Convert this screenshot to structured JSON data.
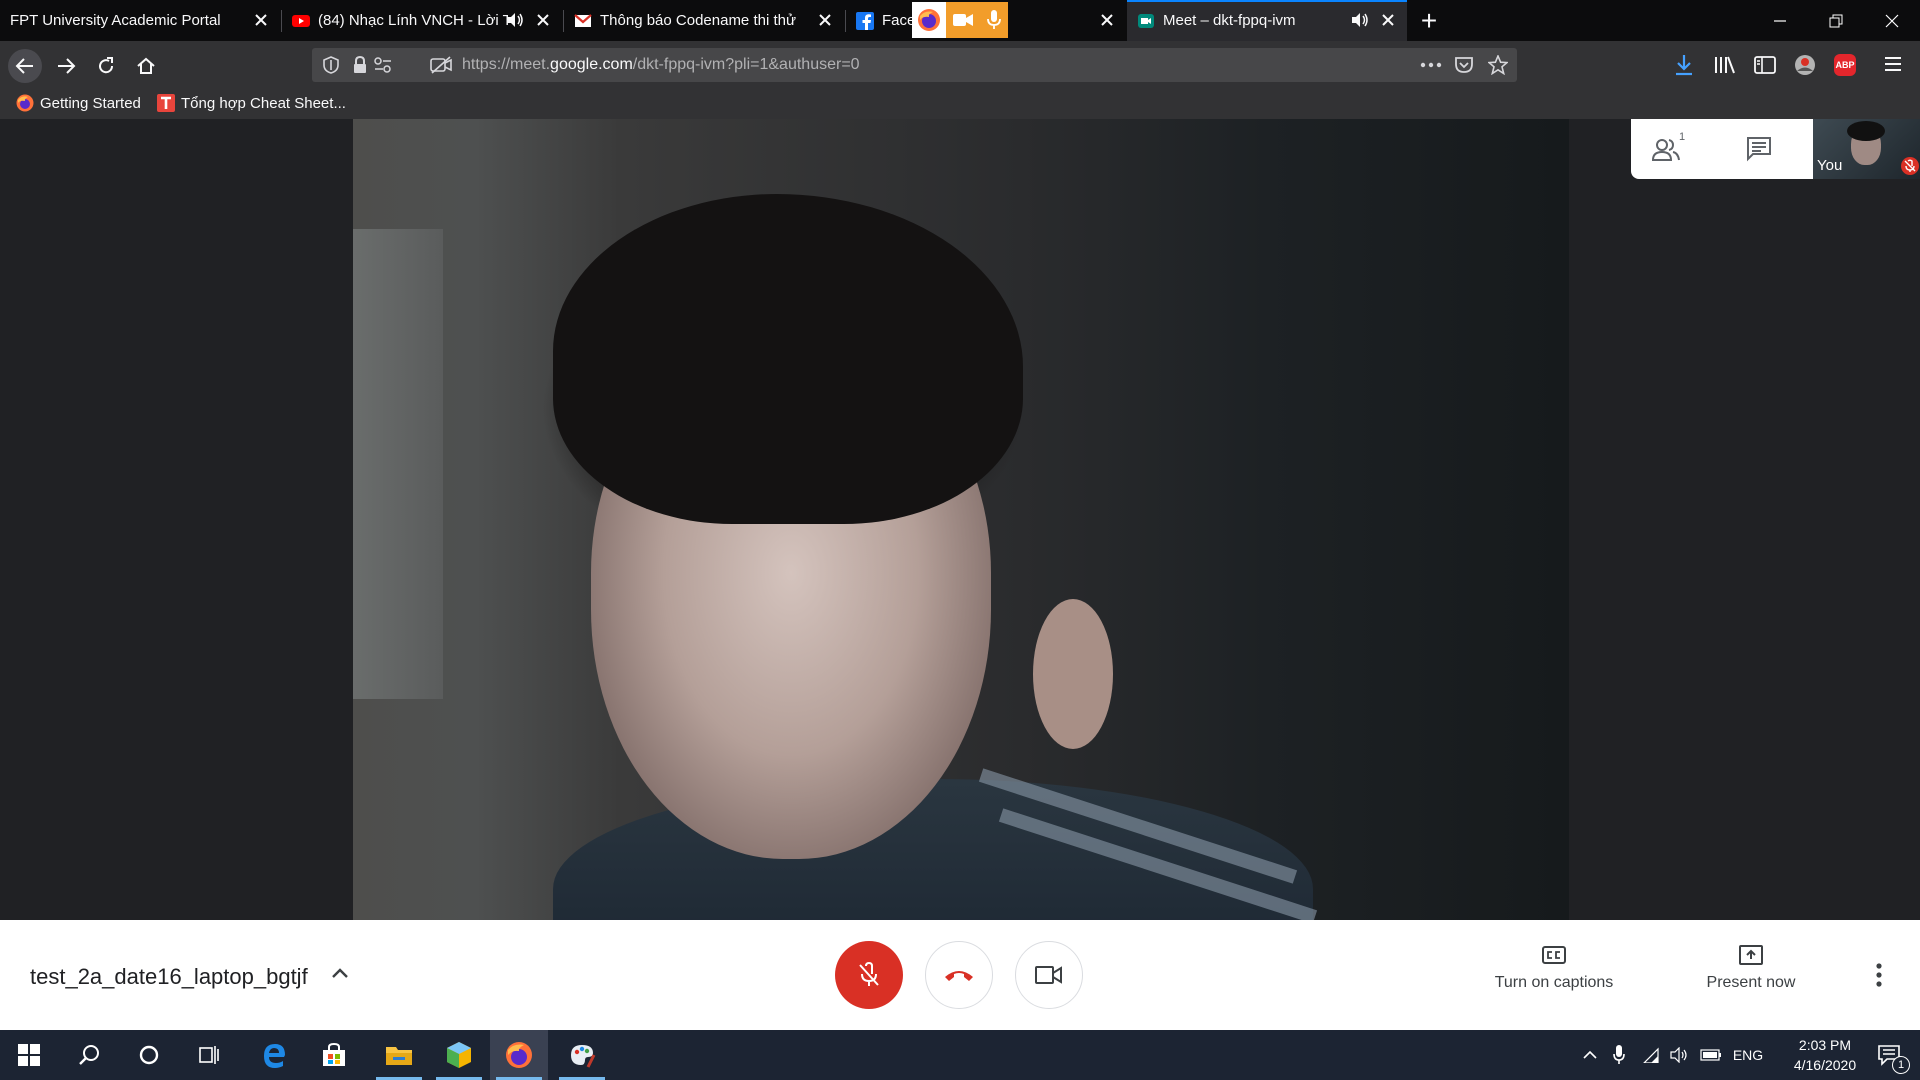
{
  "browser": {
    "tabs": [
      {
        "title": "FPT University Academic Portal",
        "favicon": "none",
        "active": false
      },
      {
        "title": "(84) Nhạc Lính VNCH - Lời T",
        "favicon": "youtube-icon",
        "playing_audio": true,
        "active": false
      },
      {
        "title": "Thông báo Codename thi thử",
        "favicon": "gmail-icon",
        "active": false
      },
      {
        "title": "Face",
        "favicon": "facebook-icon",
        "sharing_indicator": "camera-microphone",
        "active": false
      },
      {
        "title": "Meet – dkt-fppq-ivm",
        "favicon": "meet-icon",
        "playing_audio": true,
        "active": true
      }
    ],
    "new_tab_label": "+",
    "url_host": "meet.google.com",
    "url_prefix": "https://meet.",
    "url_domain": "google.com",
    "url_path": "/dkt-fppq-ivm?pli=1&authuser=0",
    "toolbar_icons": [
      "download-icon",
      "library-icon",
      "sidebar-icon",
      "account-icon",
      "adblock-plus-icon",
      "menu-icon"
    ],
    "adblock_label": "ABP"
  },
  "bookmarks": [
    {
      "label": "Getting Started",
      "icon": "firefox-icon"
    },
    {
      "label": "Tổng hợp Cheat Sheet...",
      "icon": "t-icon"
    }
  ],
  "meet": {
    "participant_count": "1",
    "self_label": "You",
    "meeting_code": "test_2a_date16_laptop_bgtjf",
    "captions_label": "Turn on captions",
    "present_label": "Present now",
    "colors": {
      "mic_muted": "#d93025",
      "hangup": "#d93025",
      "accent": "#1a73e8"
    }
  },
  "taskbar": {
    "apps": [
      "start-icon",
      "search-icon",
      "cortana-icon",
      "task-view-icon",
      "edge-icon",
      "store-icon",
      "file-explorer-icon",
      "app-cube-icon",
      "firefox-icon",
      "paint-icon"
    ],
    "language": "ENG",
    "time": "2:03 PM",
    "date": "4/16/2020",
    "notification_count": "1"
  }
}
